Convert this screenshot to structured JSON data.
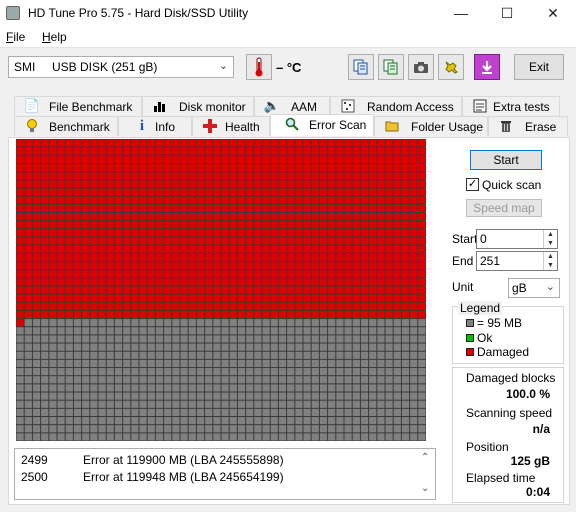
{
  "window": {
    "title": "HD Tune Pro 5.75 - Hard Disk/SSD Utility",
    "controls": [
      "—",
      "☐",
      "✕"
    ]
  },
  "menu": [
    "File",
    "Help"
  ],
  "toolbar": {
    "drive": "SMI     USB DISK (251 gB)",
    "temperature": "– °C",
    "icons": [
      "thermometer-icon",
      "copy-text-icon",
      "copy-info-icon",
      "screenshot-camera-icon",
      "options-wrench-icon",
      "save-download-icon"
    ],
    "exit_label": "Exit"
  },
  "tabs_top": [
    {
      "label": "File Benchmark",
      "icon": "file-benchmark-icon"
    },
    {
      "label": "Disk monitor",
      "icon": "disk-monitor-icon"
    },
    {
      "label": "AAM",
      "icon": "aam-speaker-icon"
    },
    {
      "label": "Random Access",
      "icon": "random-access-icon"
    },
    {
      "label": "Extra tests",
      "icon": "extra-tests-icon"
    }
  ],
  "tabs_bottom": [
    {
      "label": "Benchmark",
      "icon": "benchmark-bulb-icon"
    },
    {
      "label": "Info",
      "icon": "info-icon"
    },
    {
      "label": "Health",
      "icon": "health-cross-icon"
    },
    {
      "label": "Error Scan",
      "icon": "magnifier-icon"
    },
    {
      "label": "Folder Usage",
      "icon": "folder-icon"
    },
    {
      "label": "Erase",
      "icon": "trash-icon"
    }
  ],
  "active_tab": "Error Scan",
  "scan_grid": {
    "columns": 50,
    "rows": 37,
    "damaged_blocks": 1101,
    "colors": {
      "damaged": "#e00000",
      "unscanned": "#808080",
      "ok": "#00c000",
      "grid_line": "#3a3a3a"
    }
  },
  "log": [
    {
      "num": "2499",
      "msg": "Error at 119900 MB (LBA 245555898)"
    },
    {
      "num": "2500",
      "msg": "Error at 119948 MB (LBA 245654199)"
    }
  ],
  "controls": {
    "start_label": "Start",
    "quick_scan_label": "Quick scan",
    "quick_scan_checked": true,
    "speed_map_label": "Speed map",
    "start_field_label": "Start",
    "start_value": "0",
    "end_field_label": "End",
    "end_value": "251",
    "unit_label": "Unit",
    "unit_value": "gB"
  },
  "legend": {
    "title": "Legend",
    "items": [
      {
        "label": "= 95 MB",
        "color": "#808080"
      },
      {
        "label": "Ok",
        "color": "#00c000"
      },
      {
        "label": "Damaged",
        "color": "#e00000"
      }
    ]
  },
  "stats": {
    "damaged_blocks_label": "Damaged blocks",
    "damaged_blocks_value": "100.0 %",
    "scanning_speed_label": "Scanning speed",
    "scanning_speed_value": "n/a",
    "position_label": "Position",
    "position_value": "125 gB",
    "elapsed_time_label": "Elapsed time",
    "elapsed_time_value": "0:04"
  }
}
